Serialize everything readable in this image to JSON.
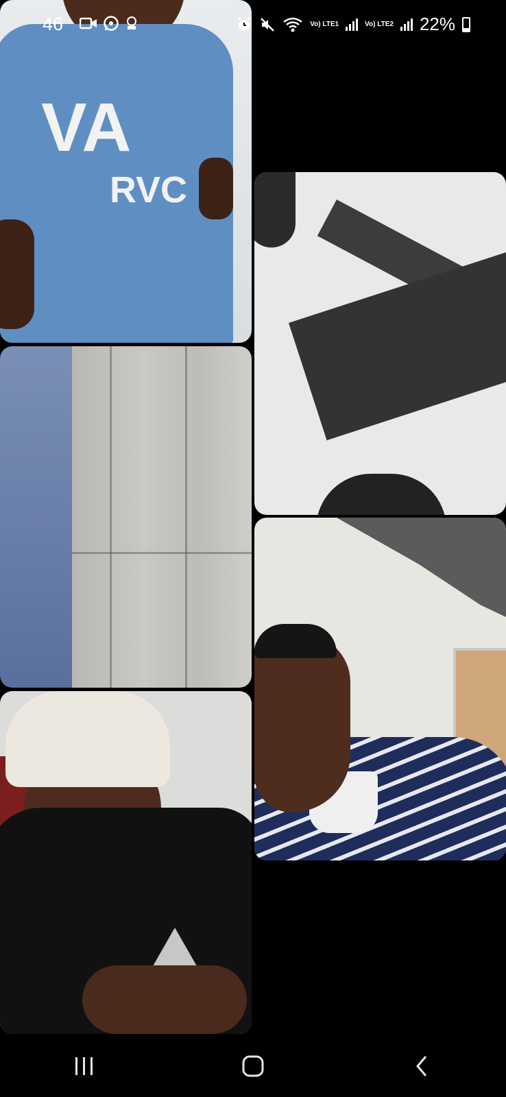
{
  "status_bar": {
    "time": "46",
    "lte1": "Vo) LTE1",
    "lte2": "Vo) LTE2",
    "battery": "22%"
  },
  "call": {
    "participants": [
      {
        "tile": "participant-tile-top-left"
      },
      {
        "tile": "participant-tile-middle-left"
      },
      {
        "tile": "participant-tile-bottom-left"
      },
      {
        "tile": "participant-tile-top-right"
      },
      {
        "tile": "participant-tile-bottom-right"
      }
    ],
    "shirt_logo_top": "VA",
    "shirt_logo_bottom": "RVC"
  },
  "navigation": {
    "icons": [
      "recent-apps-icon",
      "home-icon",
      "back-icon"
    ]
  }
}
